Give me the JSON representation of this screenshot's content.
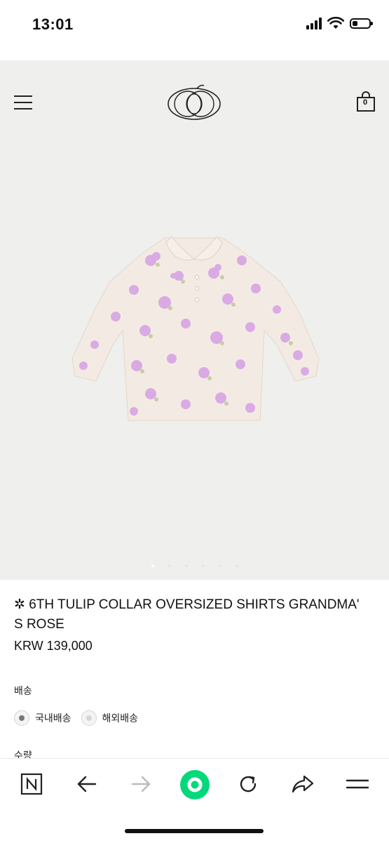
{
  "status_bar": {
    "time": "13:01",
    "battery_level": 0.3
  },
  "header": {
    "cart_count": "0"
  },
  "carousel": {
    "total": 6,
    "active_index": 0
  },
  "product": {
    "title": "✲ 6TH TULIP COLLAR OVERSIZED SHIRTS GRANDMA' S ROSE",
    "price": "KRW 139,000"
  },
  "shipping": {
    "label": "배송",
    "options": [
      {
        "label": "국내배송",
        "selected": true
      },
      {
        "label": "해외배송",
        "selected": false
      }
    ]
  },
  "quantity": {
    "label": "수량"
  },
  "toolbar": {
    "items": [
      "naver-home-icon",
      "back-arrow-icon",
      "forward-arrow-icon",
      "green-search-icon",
      "refresh-icon",
      "share-icon",
      "menu-icon"
    ],
    "accent": "#03d97a"
  }
}
